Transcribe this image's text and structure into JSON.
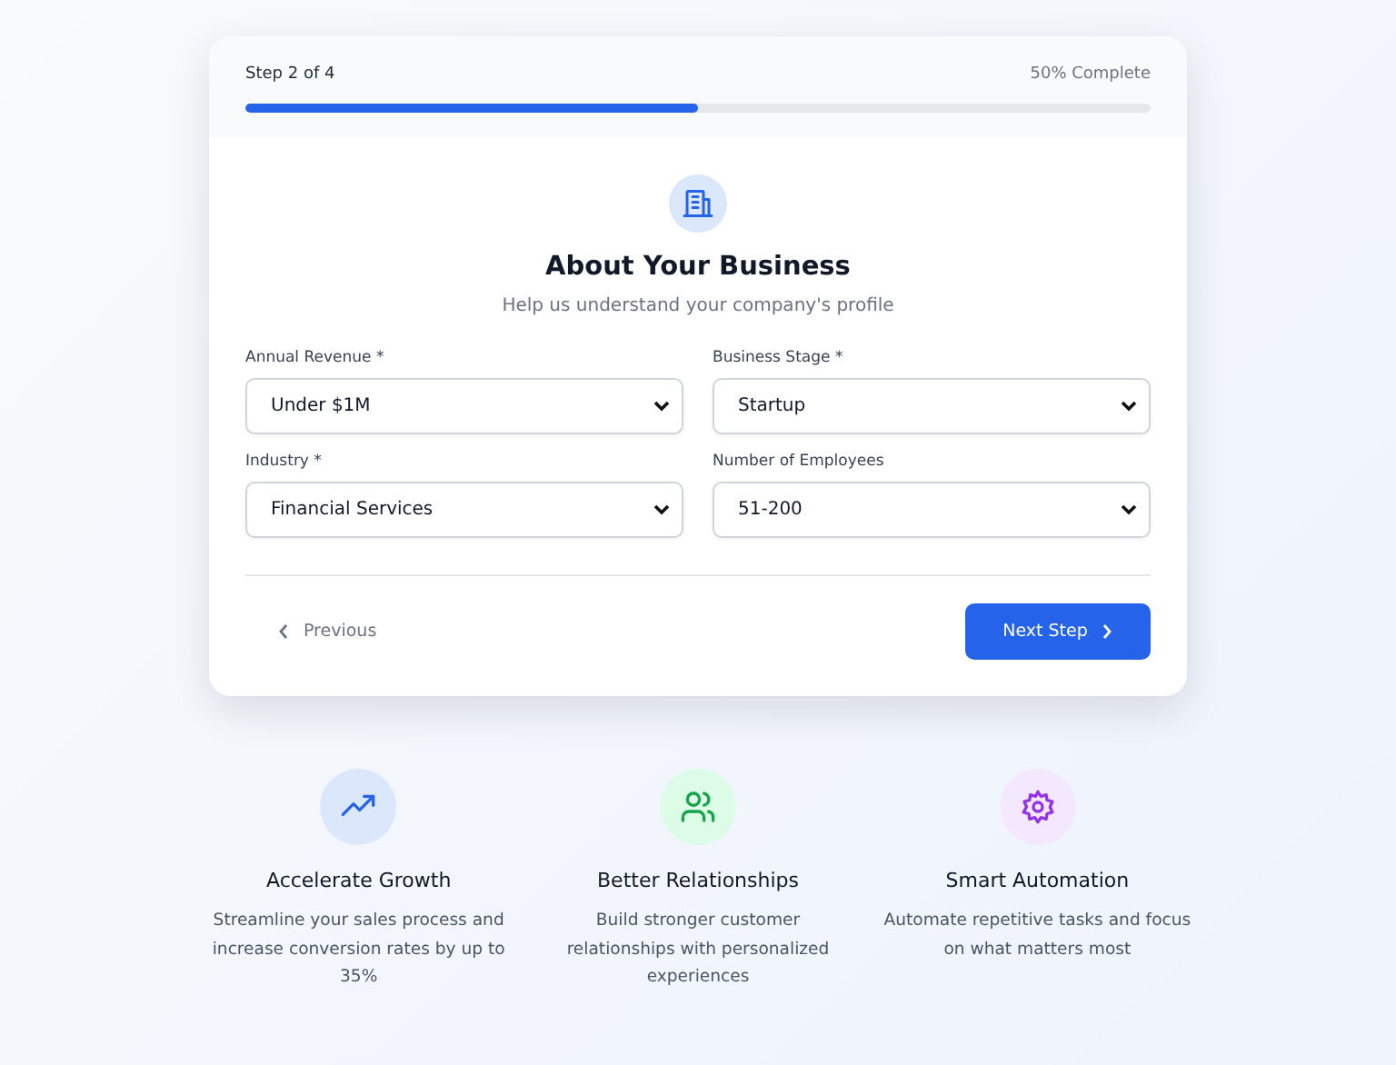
{
  "progress": {
    "step": "Step 2 of 4",
    "complete": "50% Complete",
    "level": 0.5
  },
  "section": {
    "title": "About Your Business",
    "subtitle": "Help us understand your company's profile"
  },
  "fields": [
    {
      "label": "Annual Revenue *",
      "value": "Under $1M"
    },
    {
      "label": "Business Stage *",
      "value": "Startup"
    },
    {
      "label": "Industry *",
      "value": "Financial Services"
    },
    {
      "label": "Number of Employees",
      "value": "51-200"
    }
  ],
  "buttons": {
    "previous": "Previous",
    "next": "Next Step"
  },
  "features": [
    {
      "kind": "growth",
      "title": "Accelerate Growth",
      "text": "Streamline your sales process and increase conversion rates by up to 35%"
    },
    {
      "kind": "people",
      "title": "Better Relationships",
      "text": "Build stronger customer relationships with personalized experiences"
    },
    {
      "kind": "gear",
      "title": "Smart Automation",
      "text": "Automate repetitive tasks and focus on what matters most"
    }
  ]
}
